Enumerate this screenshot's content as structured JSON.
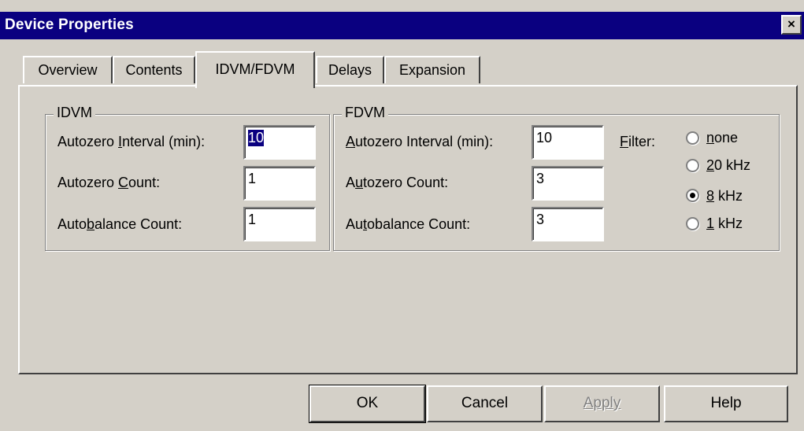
{
  "window": {
    "title": "Device Properties",
    "close_glyph": "×"
  },
  "tabs": [
    {
      "label": "Overview",
      "active": false
    },
    {
      "label": "Contents",
      "active": false
    },
    {
      "label": "IDVM/FDVM",
      "active": true
    },
    {
      "label": "Delays",
      "active": false
    },
    {
      "label": "Expansion",
      "active": false
    }
  ],
  "idvm": {
    "legend": "IDVM",
    "autozero_interval_label": "Autozero Interval (min):",
    "autozero_interval_value": "10",
    "autozero_count_label": "Autozero Count:",
    "autozero_count_value": "1",
    "autobalance_count_label": "Autobalance Count:",
    "autobalance_count_value": "1"
  },
  "fdvm": {
    "legend": "FDVM",
    "autozero_interval_label": "Autozero Interval (min):",
    "autozero_interval_value": "10",
    "autozero_count_label": "Autozero Count:",
    "autozero_count_value": "3",
    "autobalance_count_label": "Autobalance Count:",
    "autobalance_count_value": "3",
    "filter_label": "Filter:",
    "filter_options": [
      {
        "label": "none",
        "selected": false
      },
      {
        "label": "20 kHz",
        "selected": false
      },
      {
        "label": "8 kHz",
        "selected": true
      },
      {
        "label": "1 kHz",
        "selected": false
      }
    ]
  },
  "buttons": {
    "ok": "OK",
    "cancel": "Cancel",
    "apply": "Apply",
    "help": "Help"
  }
}
